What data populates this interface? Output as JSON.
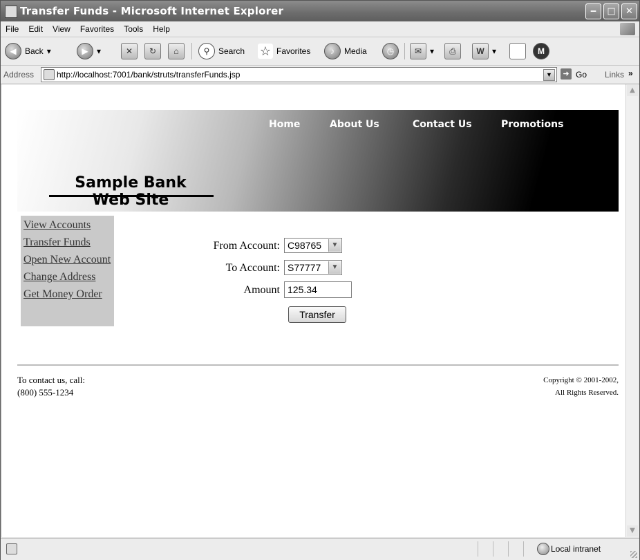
{
  "window": {
    "title": "Transfer Funds - Microsoft Internet Explorer",
    "minimize_glyph": "‒",
    "maximize_glyph": "□",
    "close_glyph": "✕"
  },
  "menu": [
    "File",
    "Edit",
    "View",
    "Favorites",
    "Tools",
    "Help"
  ],
  "toolbar": {
    "back_label": "Back",
    "search_label": "Search",
    "favorites_label": "Favorites",
    "media_label": "Media"
  },
  "addressbar": {
    "label": "Address",
    "url": "http://localhost:7001/bank/struts/transferFunds.jsp",
    "go_label": "Go",
    "links_label": "Links"
  },
  "page": {
    "nav": [
      "Home",
      "About Us",
      "Contact Us",
      "Promotions"
    ],
    "logo_line1": "Sample Bank",
    "logo_line2": "Web Site",
    "sidebar": [
      "View Accounts",
      "Transfer Funds",
      "Open New Account",
      "Change Address",
      "Get Money Order"
    ],
    "form": {
      "from_label": "From Account:",
      "from_value": "C98765",
      "to_label": "To Account:",
      "to_value": "S77777",
      "amount_label": "Amount",
      "amount_value": "125.34",
      "submit_label": "Transfer"
    },
    "footer": {
      "contact_line1": "To contact us, call:",
      "contact_line2": "(800) 555-1234",
      "copyright_line1": "Copyright © 2001-2002,",
      "copyright_line2": "All Rights Reserved."
    }
  },
  "statusbar": {
    "zone": "Local intranet"
  }
}
